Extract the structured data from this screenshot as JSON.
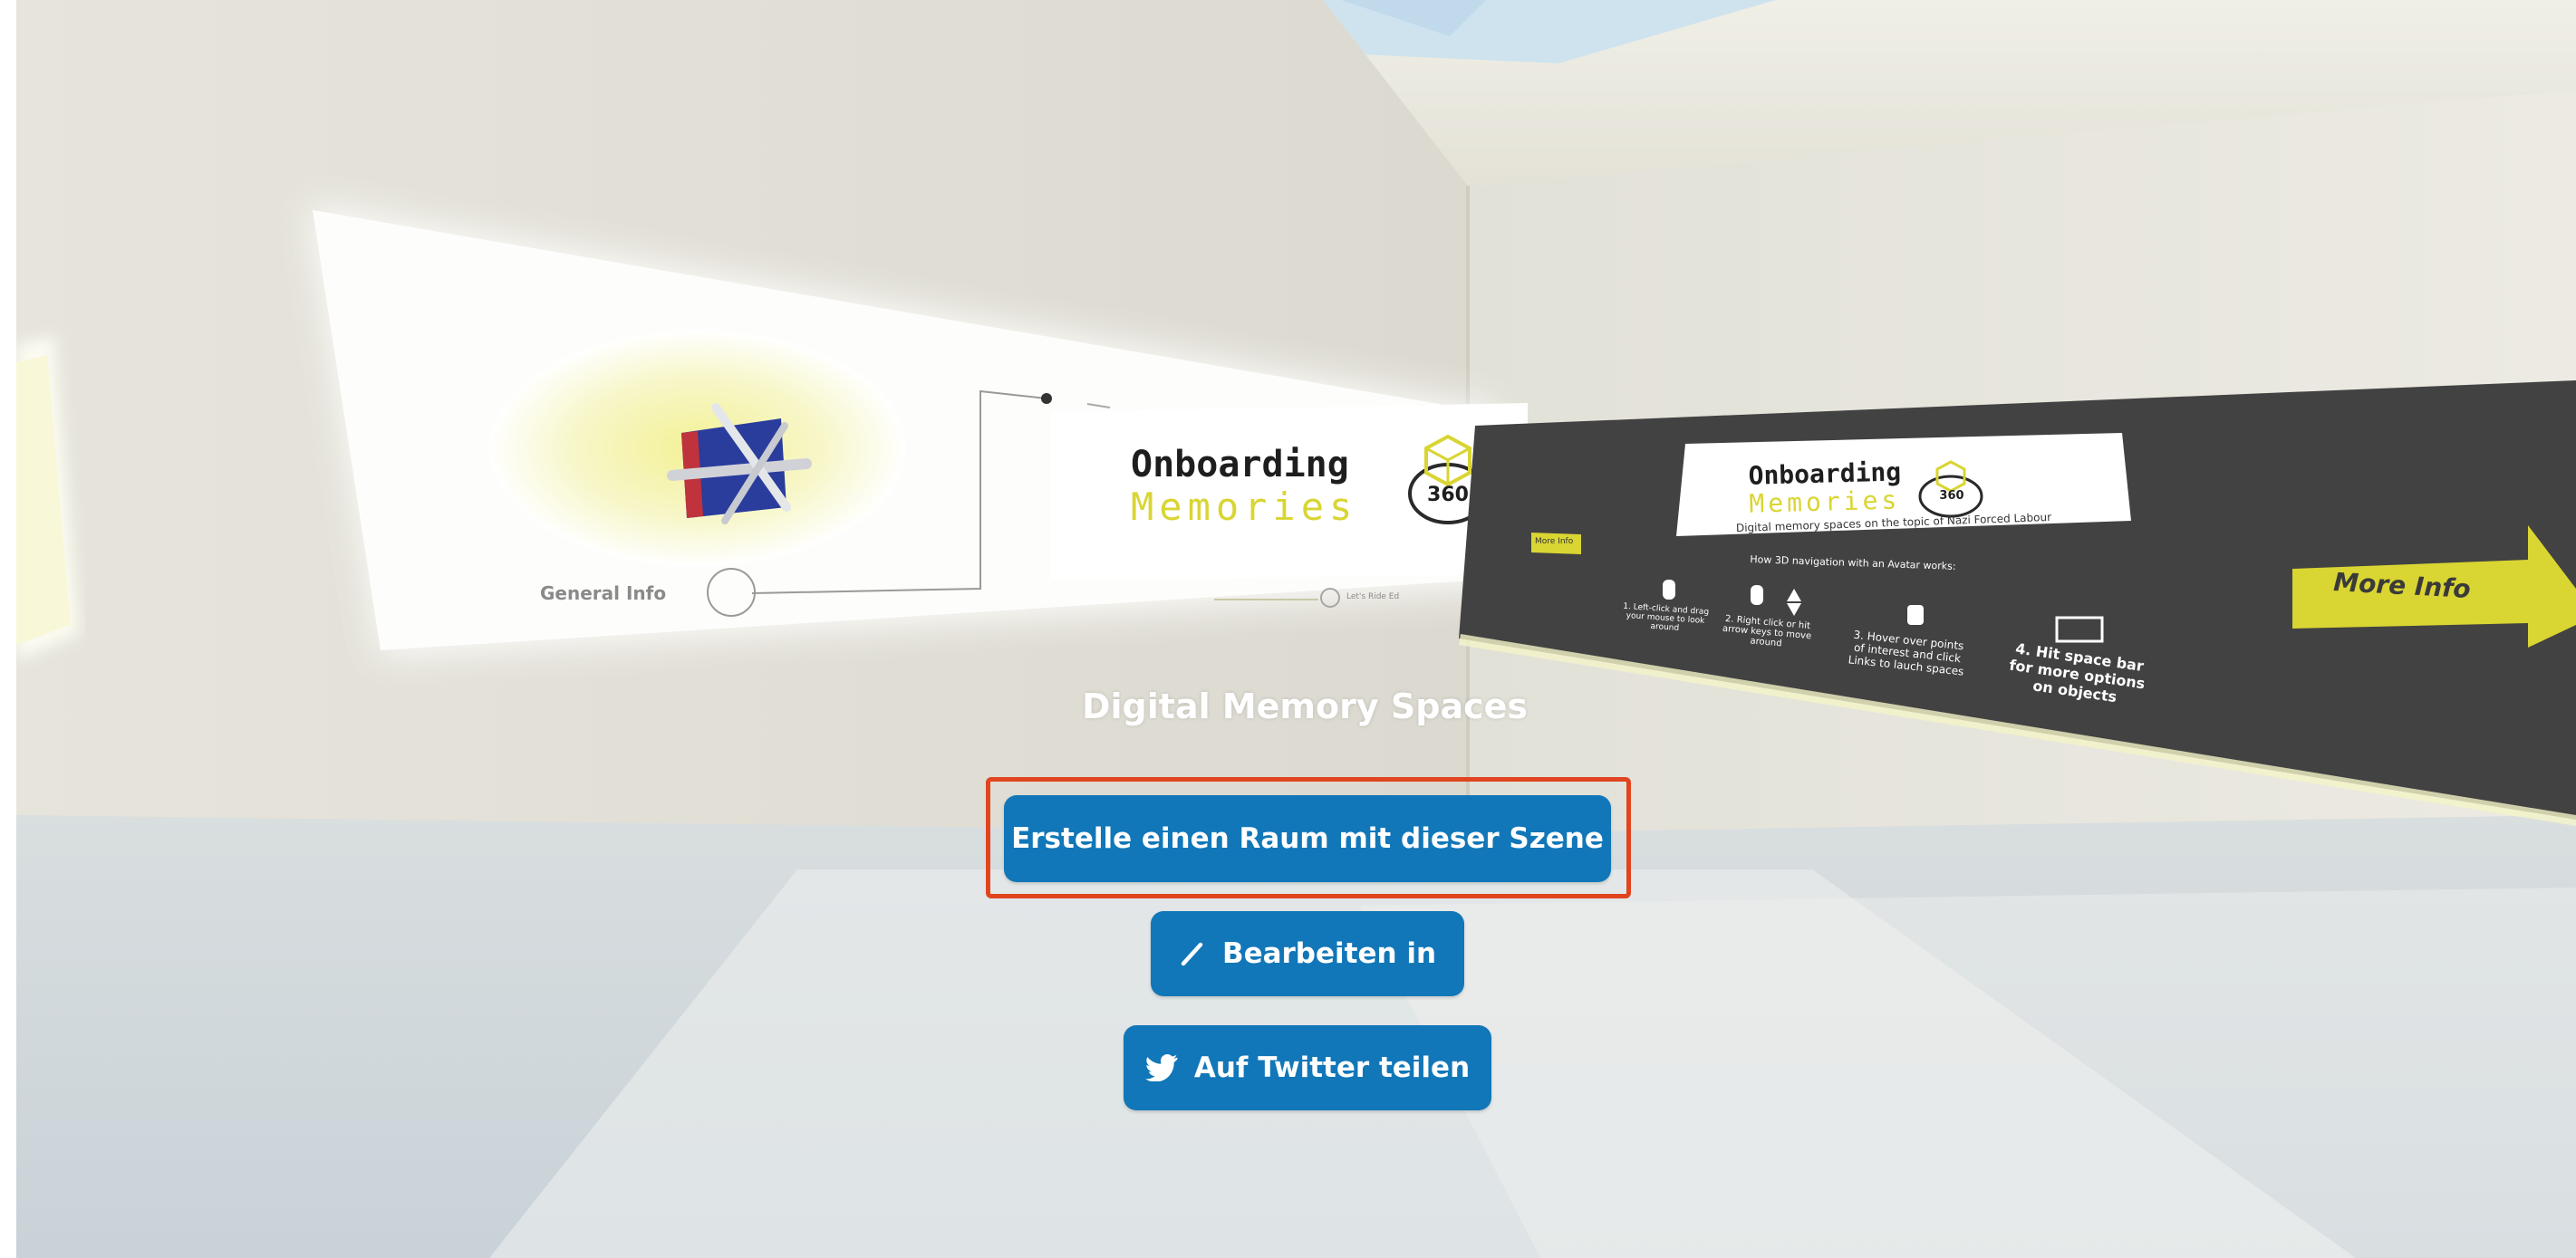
{
  "scene": {
    "title": "Digital Memory Spaces",
    "left_panel": {
      "logo_line1": "Onboarding",
      "logo_line2": "Memories",
      "badge": "360",
      "label": "General Info",
      "small_label": "Let's Ride Ed"
    },
    "right_panel": {
      "logo_line1": "Onboarding",
      "logo_line2": "Memories",
      "badge": "360",
      "subtitle": "Digital memory spaces on the topic of Nazi Forced Labour",
      "heading": "How 3D navigation with an Avatar works:",
      "tag": "More Info",
      "steps": [
        "1. Left-click and drag your mouse to look around",
        "2. Right click or hit arrow keys to move around",
        "3. Hover over points of interest and click Links to lauch spaces",
        "4. Hit space bar for more options on objects"
      ],
      "more_info": "More Info"
    }
  },
  "actions": {
    "create_room": "Erstelle einen Raum mit dieser Szene",
    "edit_in": "Bearbeiten in",
    "share_twitter": "Auf Twitter teilen"
  },
  "colors": {
    "button": "#1177b8",
    "highlight": "#e0451f",
    "logo_yellow": "#d9d532",
    "dark_panel": "#424242"
  },
  "icons": {
    "edit": "pencil-icon",
    "twitter": "twitter-bird-icon",
    "badge": "cube-360-icon",
    "arrow": "arrow-right-icon"
  }
}
